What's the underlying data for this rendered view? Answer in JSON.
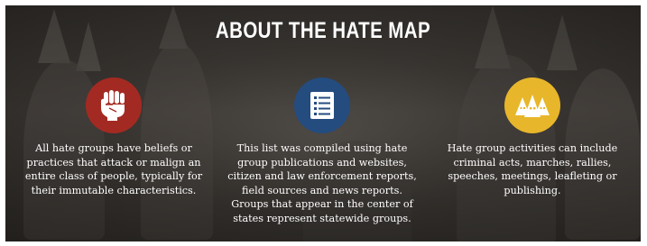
{
  "page": {
    "title": "ABOUT THE HATE MAP"
  },
  "colors": {
    "fist_circle": "#a32a22",
    "list_circle": "#244c7f",
    "hoods_circle": "#e8b62a",
    "text": "#ffffff"
  },
  "columns": [
    {
      "icon": "raised-fist-icon",
      "text": "All hate groups have beliefs or practices that attack or malign an entire class of people, typically for their immutable characteristics."
    },
    {
      "icon": "list-document-icon",
      "text": "This list was compiled using hate group publications and websites, citizen and law enforcement reports, field sources and news reports. Groups that appear in the center of states represent statewide groups."
    },
    {
      "icon": "hoods-icon",
      "text": "Hate group activities can include criminal acts, marches, rallies, speeches, meetings, leafleting or publishing."
    }
  ]
}
